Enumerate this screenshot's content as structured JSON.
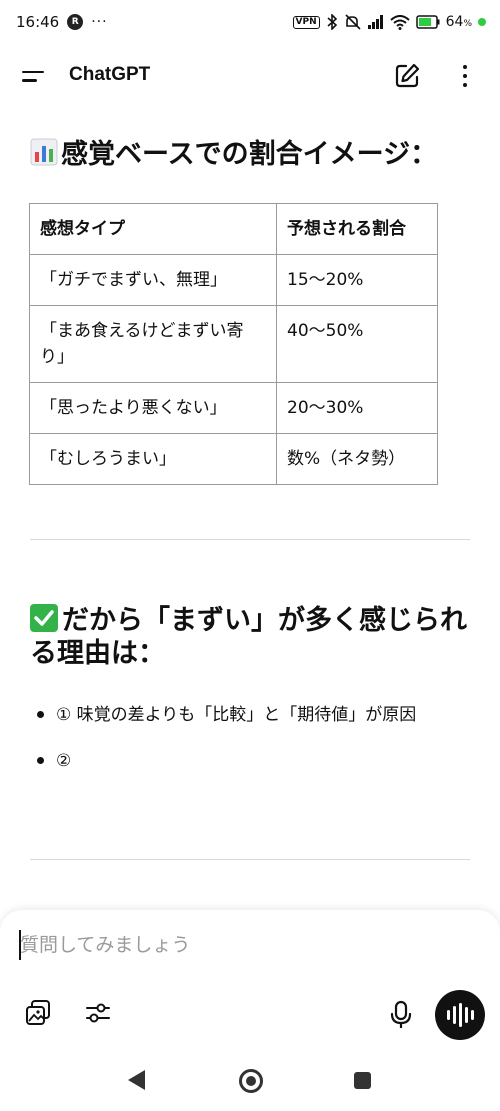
{
  "status_bar": {
    "time": "16:46",
    "badge_letter": "R",
    "more": "···",
    "vpn": "VPN",
    "battery_percent": "64"
  },
  "header": {
    "title": "ChatGPT"
  },
  "section1": {
    "heading": "感覚ベースでの割合イメージ："
  },
  "table": {
    "headers": [
      "感想タイプ",
      "予想される割合"
    ],
    "rows": [
      [
        "「ガチでまずい、無理」",
        "15〜20%"
      ],
      [
        "「まあ食えるけどまずい寄り」",
        "40〜50%"
      ],
      [
        "「思ったより悪くない」",
        "20〜30%"
      ],
      [
        "「むしろうまい」",
        "数%（ネタ勢）"
      ]
    ]
  },
  "section2": {
    "heading": "だから「まずい」が多く感じられる理由は：",
    "bullets": [
      "① 味覚の差よりも「比較」と「期待値」が原因",
      "②"
    ]
  },
  "composer": {
    "placeholder": "質問してみましょう"
  },
  "icons": {
    "menu": "menu-icon",
    "edit": "edit-icon",
    "more": "more-vertical-icon",
    "image": "image-icon",
    "tools": "tools-sliders-icon",
    "mic": "mic-icon",
    "voice": "voice-waveform-icon",
    "chart_emoji": "bar-chart-emoji-icon",
    "check_emoji": "check-mark-emoji-icon"
  },
  "colors": {
    "accent_green": "#33b249",
    "battery_green": "#2ecc40",
    "voice_button": "#111111"
  }
}
